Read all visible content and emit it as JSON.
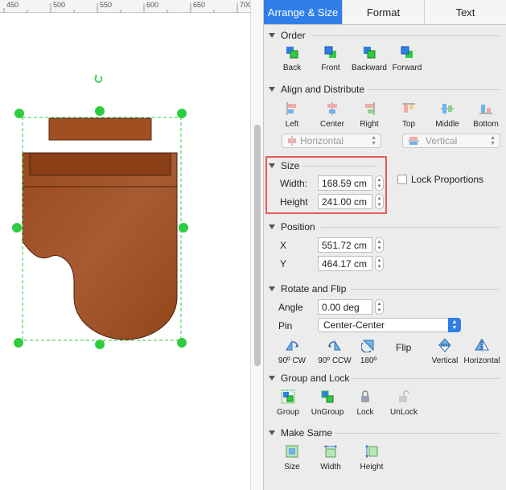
{
  "ruler": {
    "labels": [
      "450",
      "500",
      "550",
      "600",
      "650",
      "700"
    ]
  },
  "tabs": [
    {
      "label": "Arrange & Size",
      "active": true
    },
    {
      "label": "Format",
      "active": false
    },
    {
      "label": "Text",
      "active": false
    }
  ],
  "order": {
    "title": "Order",
    "buttons": [
      "Back",
      "Front",
      "Backward",
      "Forward"
    ]
  },
  "align": {
    "title": "Align and Distribute",
    "buttons": [
      "Left",
      "Center",
      "Right",
      "Top",
      "Middle",
      "Bottom"
    ],
    "horizontal_label": "Horizontal",
    "vertical_label": "Vertical"
  },
  "size": {
    "title": "Size",
    "width_label": "Width:",
    "width_value": "168.59 cm",
    "height_label": "Height",
    "height_value": "241.00 cm",
    "lock_label": "Lock Proportions"
  },
  "position": {
    "title": "Position",
    "x_label": "X",
    "x_value": "551.72 cm",
    "y_label": "Y",
    "y_value": "464.17 cm"
  },
  "rotate": {
    "title": "Rotate and Flip",
    "angle_label": "Angle",
    "angle_value": "0.00 deg",
    "pin_label": "Pin",
    "pin_value": "Center-Center",
    "buttons": [
      "90º CW",
      "90º CCW",
      "180º"
    ],
    "flip_label": "Flip",
    "flip_buttons": [
      "Vertical",
      "Horizontal"
    ]
  },
  "group": {
    "title": "Group and Lock",
    "buttons": [
      "Group",
      "UnGroup",
      "Lock",
      "UnLock"
    ]
  },
  "same": {
    "title": "Make Same",
    "buttons": [
      "Size",
      "Width",
      "Height"
    ]
  },
  "colors": {
    "accent": "#2f7ee8",
    "highlight": "#e55b52",
    "handle": "#2ecc40",
    "shape": "#a0522d"
  }
}
